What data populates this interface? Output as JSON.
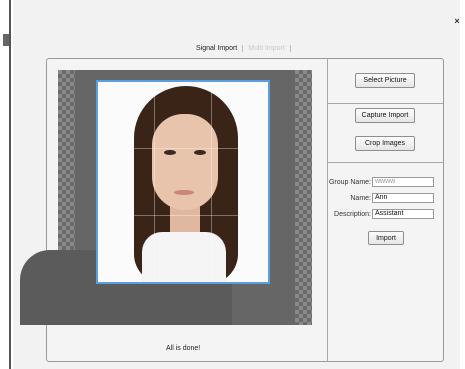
{
  "window": {
    "close_glyph": "×"
  },
  "tabs": [
    {
      "label": "Signal Import",
      "active": true
    },
    {
      "label": "Multi Import",
      "active": false
    }
  ],
  "preview": {
    "status_text": "All is done!"
  },
  "actions": {
    "select_picture": "Select Picture",
    "capture_import": "Capture Import",
    "crop_images": "Crop Images"
  },
  "form": {
    "group_name": {
      "label": "Group Name:",
      "value": "wwww"
    },
    "name": {
      "label": "Name:",
      "value": "Ann"
    },
    "description": {
      "label": "Description:",
      "value": "Assistant"
    },
    "import_button": "Import"
  },
  "colors": {
    "selection_border": "#5aa0e0",
    "inactive_tab": "#c9c9c9"
  }
}
